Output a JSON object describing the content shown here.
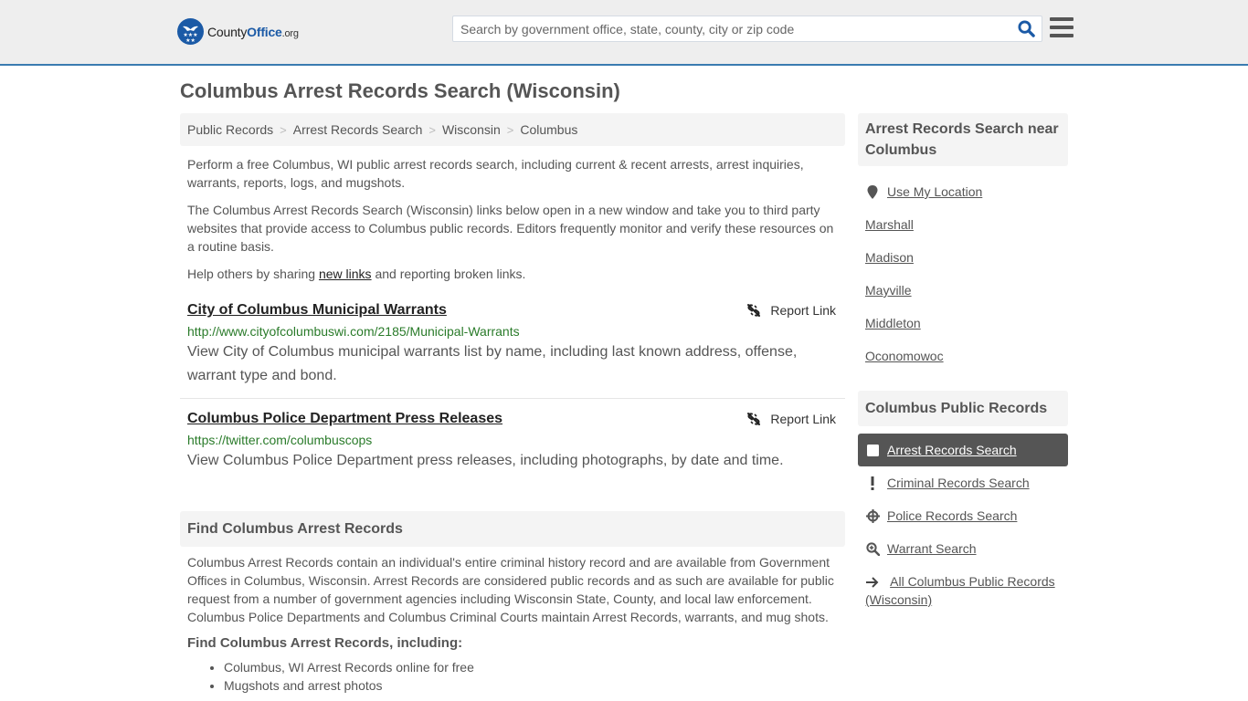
{
  "header": {
    "logo": {
      "prefix": "County",
      "brand": "Office",
      "tld": ".org"
    },
    "search": {
      "placeholder": "Search by government office, state, county, city or zip code",
      "value": ""
    },
    "search_icon": "search-icon",
    "menu_icon": "hamburger-menu-icon"
  },
  "page": {
    "title": "Columbus Arrest Records Search (Wisconsin)"
  },
  "breadcrumb": [
    {
      "label": "Public Records"
    },
    {
      "label": "Arrest Records Search"
    },
    {
      "label": "Wisconsin"
    },
    {
      "label": "Columbus"
    }
  ],
  "breadcrumb_separator": ">",
  "intro": {
    "p1": "Perform a free Columbus, WI public arrest records search, including current & recent arrests, arrest inquiries, warrants, reports, logs, and mugshots.",
    "p2": "The Columbus Arrest Records Search (Wisconsin) links below open in a new window and take you to third party websites that provide access to Columbus public records. Editors frequently monitor and verify these resources on a routine basis.",
    "p3_before": "Help others by sharing ",
    "p3_link": "new links",
    "p3_after": " and reporting broken links."
  },
  "listings": [
    {
      "title": "City of Columbus Municipal Warrants",
      "url": "http://www.cityofcolumbuswi.com/2185/Municipal-Warrants",
      "description": "View City of Columbus municipal warrants list by name, including last known address, offense, warrant type and bond.",
      "report_label": "Report Link"
    },
    {
      "title": "Columbus Police Department Press Releases",
      "url": "https://twitter.com/columbuscops",
      "description": "View Columbus Police Department press releases, including photographs, by date and time.",
      "report_label": "Report Link"
    }
  ],
  "find_section": {
    "heading": "Find Columbus Arrest Records",
    "body": "Columbus Arrest Records contain an individual's entire criminal history record and are available from Government Offices in Columbus, Wisconsin. Arrest Records are considered public records and as such are available for public request from a number of government agencies including Wisconsin State, County, and local law enforcement. Columbus Police Departments and Columbus Criminal Courts maintain Arrest Records, warrants, and mug shots.",
    "subheading": "Find Columbus Arrest Records, including:",
    "bullets": [
      "Columbus, WI Arrest Records online for free",
      "Mugshots and arrest photos"
    ]
  },
  "sidebar": {
    "nearby_heading": "Arrest Records Search near Columbus",
    "use_location": "Use My Location",
    "nearby": [
      "Marshall",
      "Madison",
      "Mayville",
      "Middleton",
      "Oconomowoc"
    ],
    "records_heading": "Columbus Public Records",
    "records": [
      {
        "label": "Arrest Records Search",
        "icon": "square-icon",
        "active": true
      },
      {
        "label": "Criminal Records Search",
        "icon": "exclamation-icon",
        "active": false
      },
      {
        "label": "Police Records Search",
        "icon": "crosshair-icon",
        "active": false
      },
      {
        "label": "Warrant Search",
        "icon": "zoom-in-icon",
        "active": false
      }
    ],
    "all_records": "All Columbus Public Records (Wisconsin)"
  },
  "colors": {
    "brand_blue": "#1b5aa6",
    "header_border": "#3a7bb0",
    "url_green": "#2a7b2a",
    "active_item_bg": "#555555"
  }
}
